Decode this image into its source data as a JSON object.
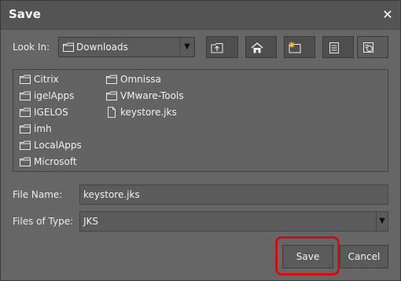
{
  "dialog": {
    "title": "Save",
    "close_glyph": "✕"
  },
  "lookin": {
    "label": "Look In:",
    "value": "Downloads"
  },
  "toolbar": {
    "buttons": [
      {
        "icon": "up-folder-icon"
      },
      {
        "icon": "home-icon"
      },
      {
        "icon": "new-folder-icon"
      },
      {
        "icon": "list-view-icon"
      },
      {
        "icon": "details-view-icon"
      }
    ]
  },
  "files": [
    {
      "name": "Citrix",
      "type": "folder"
    },
    {
      "name": "igelApps",
      "type": "folder"
    },
    {
      "name": "IGELOS",
      "type": "folder"
    },
    {
      "name": "imh",
      "type": "folder"
    },
    {
      "name": "LocalApps",
      "type": "folder"
    },
    {
      "name": "Microsoft",
      "type": "folder"
    },
    {
      "name": "Omnissa",
      "type": "folder"
    },
    {
      "name": "VMware-Tools",
      "type": "folder"
    },
    {
      "name": "keystore.jks",
      "type": "file"
    }
  ],
  "filename": {
    "label": "File Name:",
    "value": "keystore.jks"
  },
  "filetype": {
    "label": "Files of Type:",
    "value": "JKS"
  },
  "buttons": {
    "save": "Save",
    "cancel": "Cancel"
  },
  "colors": {
    "highlight": "#d01010",
    "background": "#666666"
  }
}
